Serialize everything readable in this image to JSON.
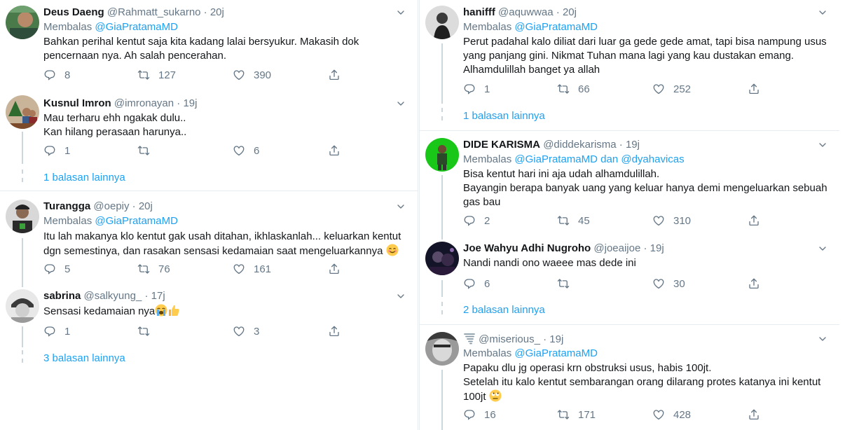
{
  "reply_prefix": "Membalas",
  "and_word": "dan",
  "more_label": "balasan lainnya",
  "icons": [
    "reply-icon",
    "retweet-icon",
    "like-icon",
    "share-icon",
    "chevron-down-icon"
  ],
  "left": {
    "tweets": [
      {
        "name": "Deus Daeng",
        "handle": "@Rahmatt_sukarno",
        "time": "20j",
        "reply_to": "@GiaPratamaMD",
        "lines": [
          "Bahkan perihal kentut saja kita kadang lalai bersyukur. Makasih dok",
          "pencernaan nya. Ah salah pencerahan."
        ],
        "replies": "8",
        "retweets": "127",
        "likes": "390"
      },
      {
        "name": "Kusnul Imron",
        "handle": "@imronayan",
        "time": "19j",
        "lines": [
          "Mau terharu ehh ngakak dulu..",
          "Kan hilang perasaan harunya.."
        ],
        "replies": "1",
        "retweets": "",
        "likes": "6",
        "more_count": "1"
      },
      {
        "name": "Turangga",
        "handle": "@oepiy",
        "time": "20j",
        "reply_to": "@GiaPratamaMD",
        "lines": [
          "Itu lah makanya klo kentut gak usah ditahan, ikhlaskanlah... keluarkan kentut",
          "dgn semestinya, dan rasakan sensasi kedamaian saat mengeluarkannya"
        ],
        "emoji": "😊",
        "replies": "5",
        "retweets": "76",
        "likes": "161"
      },
      {
        "name": "sabrina",
        "handle": "@salkyung_",
        "time": "17j",
        "lines": [
          "Sensasi kedamaian nya"
        ],
        "emoji": "😭👍",
        "replies": "1",
        "retweets": "",
        "likes": "3",
        "more_count": "3"
      }
    ]
  },
  "right": {
    "tweets": [
      {
        "name": "hanifff",
        "handle": "@aquwwaa",
        "time": "20j",
        "reply_to": "@GiaPratamaMD",
        "lines": [
          "Perut padahal kalo diliat dari luar ga gede gede amat, tapi bisa nampung usus",
          "yang panjang gini. Nikmat Tuhan mana lagi yang kau dustakan emang.",
          "Alhamdulillah banget ya allah"
        ],
        "replies": "1",
        "retweets": "66",
        "likes": "252",
        "more_count": "1"
      },
      {
        "name": "DIDE KARISMA",
        "handle": "@diddekarisma",
        "time": "19j",
        "reply_to": "@GiaPratamaMD",
        "reply_to_2": "@dyahavicas",
        "lines": [
          "Bisa kentut hari ini aja udah alhamdulillah.",
          "Bayangin berapa banyak uang yang keluar hanya demi mengeluarkan sebuah",
          "gas bau"
        ],
        "replies": "2",
        "retweets": "45",
        "likes": "310"
      },
      {
        "name": "Joe Wahyu Adhi Nugroho",
        "handle": "@joeaijoe",
        "time": "19j",
        "lines": [
          "Nandi nandi ono waeee mas dede ini"
        ],
        "replies": "6",
        "retweets": "",
        "likes": "30",
        "more_count": "2"
      },
      {
        "name": "",
        "handle": "@miserious_",
        "time": "19j",
        "reply_to": "@GiaPratamaMD",
        "lines": [
          "Papaku dlu jg operasi krn obstruksi usus, habis 100jt.",
          "Setelah itu kalo kentut sembarangan orang dilarang protes katanya ini kentut",
          "100jt"
        ],
        "emoji": "🙄",
        "replies": "16",
        "retweets": "171",
        "likes": "428"
      }
    ]
  }
}
